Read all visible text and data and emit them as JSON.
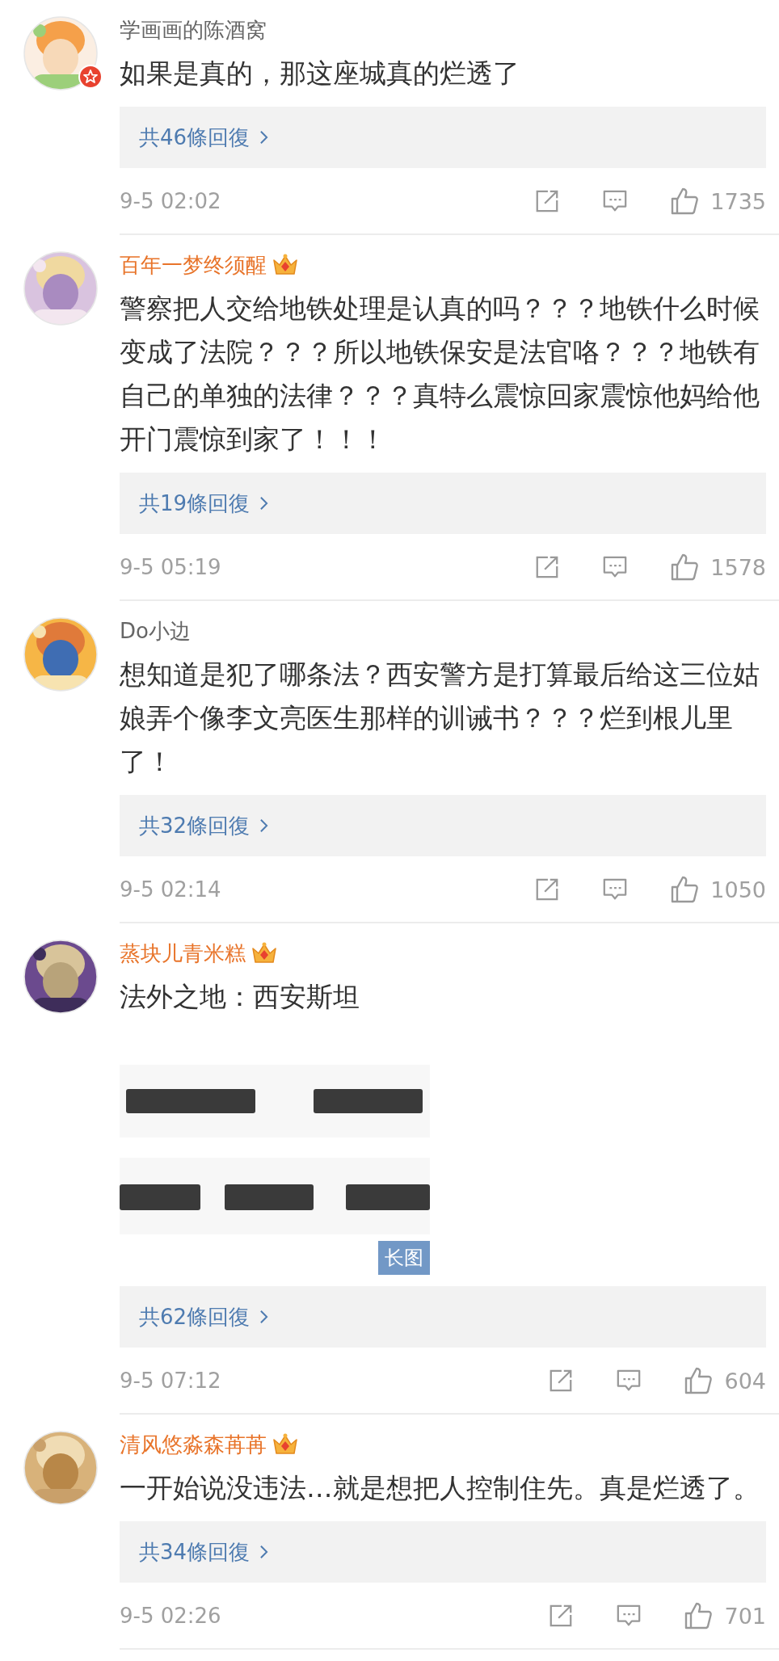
{
  "comments": [
    {
      "user": {
        "name": "学画画的陈酒窝",
        "vip": false,
        "verified_badge": true
      },
      "text": "如果是真的，那这座城真的烂透了",
      "replies": "共46條回復",
      "time": "9-5 02:02",
      "likes": "1735"
    },
    {
      "user": {
        "name": "百年一梦终须醒",
        "vip": true,
        "verified_badge": false
      },
      "text": "警察把人交给地铁处理是认真的吗？？？地铁什么时候变成了法院？？？所以地铁保安是法官咯？？？地铁有自己的单独的法律？？？真特么震惊回家震惊他妈给他开门震惊到家了！！！",
      "replies": "共19條回復",
      "time": "9-5 05:19",
      "likes": "1578"
    },
    {
      "user": {
        "name": "Do小边",
        "vip": false,
        "verified_badge": false
      },
      "text": "想知道是犯了哪条法？西安警方是打算最后给这三位姑娘弄个像李文亮医生那样的训诫书？？？烂到根儿里了！",
      "replies": "共32條回復",
      "time": "9-5 02:14",
      "likes": "1050"
    },
    {
      "user": {
        "name": "蒸块儿青米糕",
        "vip": true,
        "verified_badge": false
      },
      "text": "法外之地：西安斯坦",
      "image": {
        "kind": "picture",
        "badge": "长图"
      },
      "replies": "共62條回復",
      "time": "9-5 07:12",
      "likes": "604"
    },
    {
      "user": {
        "name": "清风悠淼森苒苒",
        "vip": true,
        "verified_badge": false
      },
      "text": "一开始说没违法…就是想把人控制住先。真是烂透了。",
      "replies": "共34條回復",
      "time": "9-5 02:26",
      "likes": "701"
    }
  ]
}
